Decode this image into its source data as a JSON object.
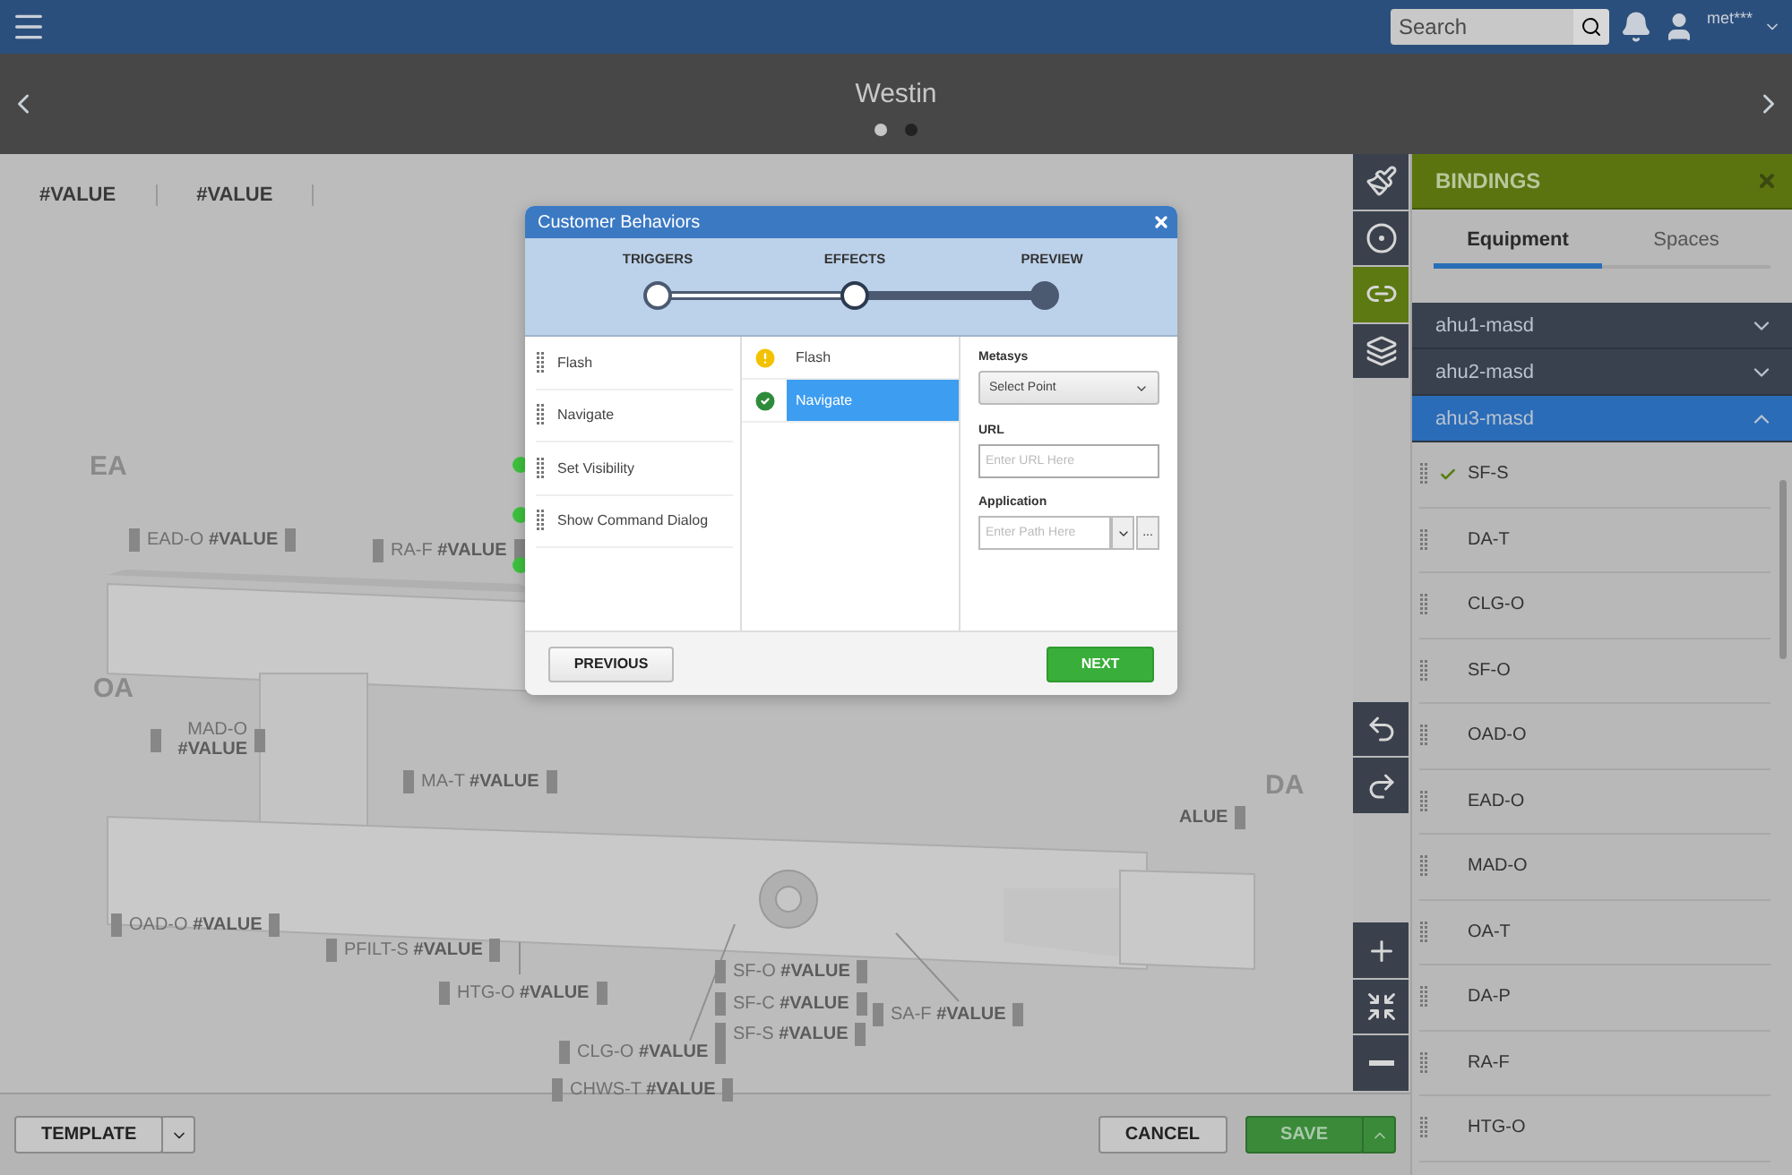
{
  "topbar": {
    "search": {
      "placeholder": "Search"
    },
    "user": "met***"
  },
  "header": {
    "title": "Westin",
    "pages": [
      {
        "selected": true
      },
      {
        "selected": false
      }
    ]
  },
  "canvas": {
    "stats": [
      "#VALUE",
      "#VALUE"
    ],
    "areas": [
      "EA",
      "OA",
      "DA"
    ],
    "points": [
      {
        "name": "EAD-O",
        "value": "#VALUE"
      },
      {
        "name": "RA-F",
        "value": "#VALUE"
      },
      {
        "name": "MAD-O",
        "value": "#VALUE"
      },
      {
        "name": "MA-T",
        "value": "#VALUE"
      },
      {
        "name": "OAD-O",
        "value": "#VALUE"
      },
      {
        "name": "PFILT-S",
        "value": "#VALUE"
      },
      {
        "name": "HTG-O",
        "value": "#VALUE"
      },
      {
        "name": "CLG-O",
        "value": "#VALUE"
      },
      {
        "name": "CHWS-T",
        "value": "#VALUE"
      },
      {
        "name": "SF-O",
        "value": "#VALUE"
      },
      {
        "name": "SF-C",
        "value": "#VALUE"
      },
      {
        "name": "SF-S",
        "value": "#VALUE"
      },
      {
        "name": "SA-F",
        "value": "#VALUE"
      },
      {
        "value": "ALUE"
      }
    ]
  },
  "modal": {
    "title": "Customer Behaviors",
    "steps": [
      {
        "label": "TRIGGERS",
        "done": true,
        "selected": false
      },
      {
        "label": "EFFECTS",
        "done": false,
        "selected": true
      },
      {
        "label": "PREVIEW",
        "done": false,
        "selected": false
      }
    ],
    "triggers": [
      "Flash",
      "Navigate",
      "Set Visibility",
      "Show Command Dialog"
    ],
    "effects": [
      {
        "label": "Flash",
        "kind": "warning",
        "selected": false
      },
      {
        "label": "Navigate",
        "kind": "ok",
        "selected": true
      }
    ],
    "fields": [
      {
        "label": "Metasys",
        "kind": "select",
        "value": "Select Point"
      },
      {
        "label": "URL",
        "kind": "text",
        "placeholder": "Enter URL Here"
      },
      {
        "label": "Application",
        "kind": "combo",
        "placeholder": "Enter Path Here",
        "more": "..."
      }
    ],
    "previous": "PREVIOUS",
    "next": "NEXT"
  },
  "tools": [
    {
      "kind": "brush",
      "selected": false
    },
    {
      "kind": "ring",
      "selected": false
    },
    {
      "kind": "link",
      "selected": true
    },
    {
      "kind": "layers",
      "selected": false
    }
  ],
  "history": [
    {
      "kind": "undo"
    },
    {
      "kind": "redo"
    }
  ],
  "zoom": [
    {
      "kind": "in"
    },
    {
      "kind": "fit"
    },
    {
      "kind": "out"
    }
  ],
  "bindings": {
    "title": "BINDINGS",
    "tabs": [
      {
        "label": "Equipment",
        "selected": true
      },
      {
        "label": "Spaces",
        "selected": false
      }
    ],
    "groups": [
      {
        "name": "ahu1-masd",
        "expanded": false
      },
      {
        "name": "ahu2-masd",
        "expanded": false
      },
      {
        "name": "ahu3-masd",
        "expanded": true,
        "items": [
          {
            "label": "SF-S",
            "checked": true
          },
          {
            "label": "DA-T",
            "checked": false
          },
          {
            "label": "CLG-O",
            "checked": false
          },
          {
            "label": "SF-O",
            "checked": false
          },
          {
            "label": "OAD-O",
            "checked": false
          },
          {
            "label": "EAD-O",
            "checked": false
          },
          {
            "label": "MAD-O",
            "checked": false
          },
          {
            "label": "OA-T",
            "checked": false
          },
          {
            "label": "DA-P",
            "checked": false
          },
          {
            "label": "RA-F",
            "checked": false
          },
          {
            "label": "HTG-O",
            "checked": false
          }
        ]
      }
    ]
  },
  "footer": {
    "template": "TEMPLATE",
    "cancel": "CANCEL",
    "save": "SAVE"
  }
}
